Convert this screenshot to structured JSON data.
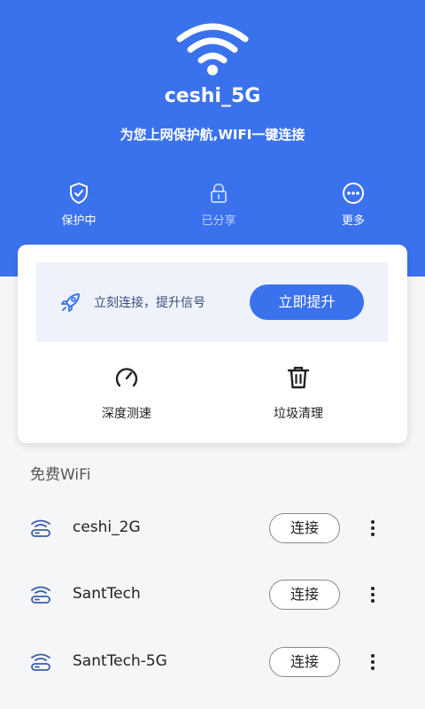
{
  "header": {
    "ssid": "ceshi_5G",
    "tagline": "为您上网保护航,WIFI一键连接",
    "bg_color": "#3a72ee",
    "wifi_icon": "wifi-icon"
  },
  "status_items": [
    {
      "label": "保护中",
      "icon": "shield-check-icon"
    },
    {
      "label": "已分享",
      "icon": "lock-icon"
    },
    {
      "label": "更多",
      "icon": "more-circle-icon"
    }
  ],
  "boost": {
    "text": "立刻连接，提升信号",
    "button_label": "立即提升",
    "icon": "rocket-icon"
  },
  "tools": [
    {
      "label": "深度测速",
      "icon": "speedometer-icon"
    },
    {
      "label": "垃圾清理",
      "icon": "trash-icon"
    }
  ],
  "section_title": "免费WiFi",
  "networks": [
    {
      "name": "ceshi_2G",
      "action": "连接"
    },
    {
      "name": "SantTech",
      "action": "连接"
    },
    {
      "name": "SantTech-5G",
      "action": "连接"
    }
  ],
  "accent_color": "#3a72ee"
}
